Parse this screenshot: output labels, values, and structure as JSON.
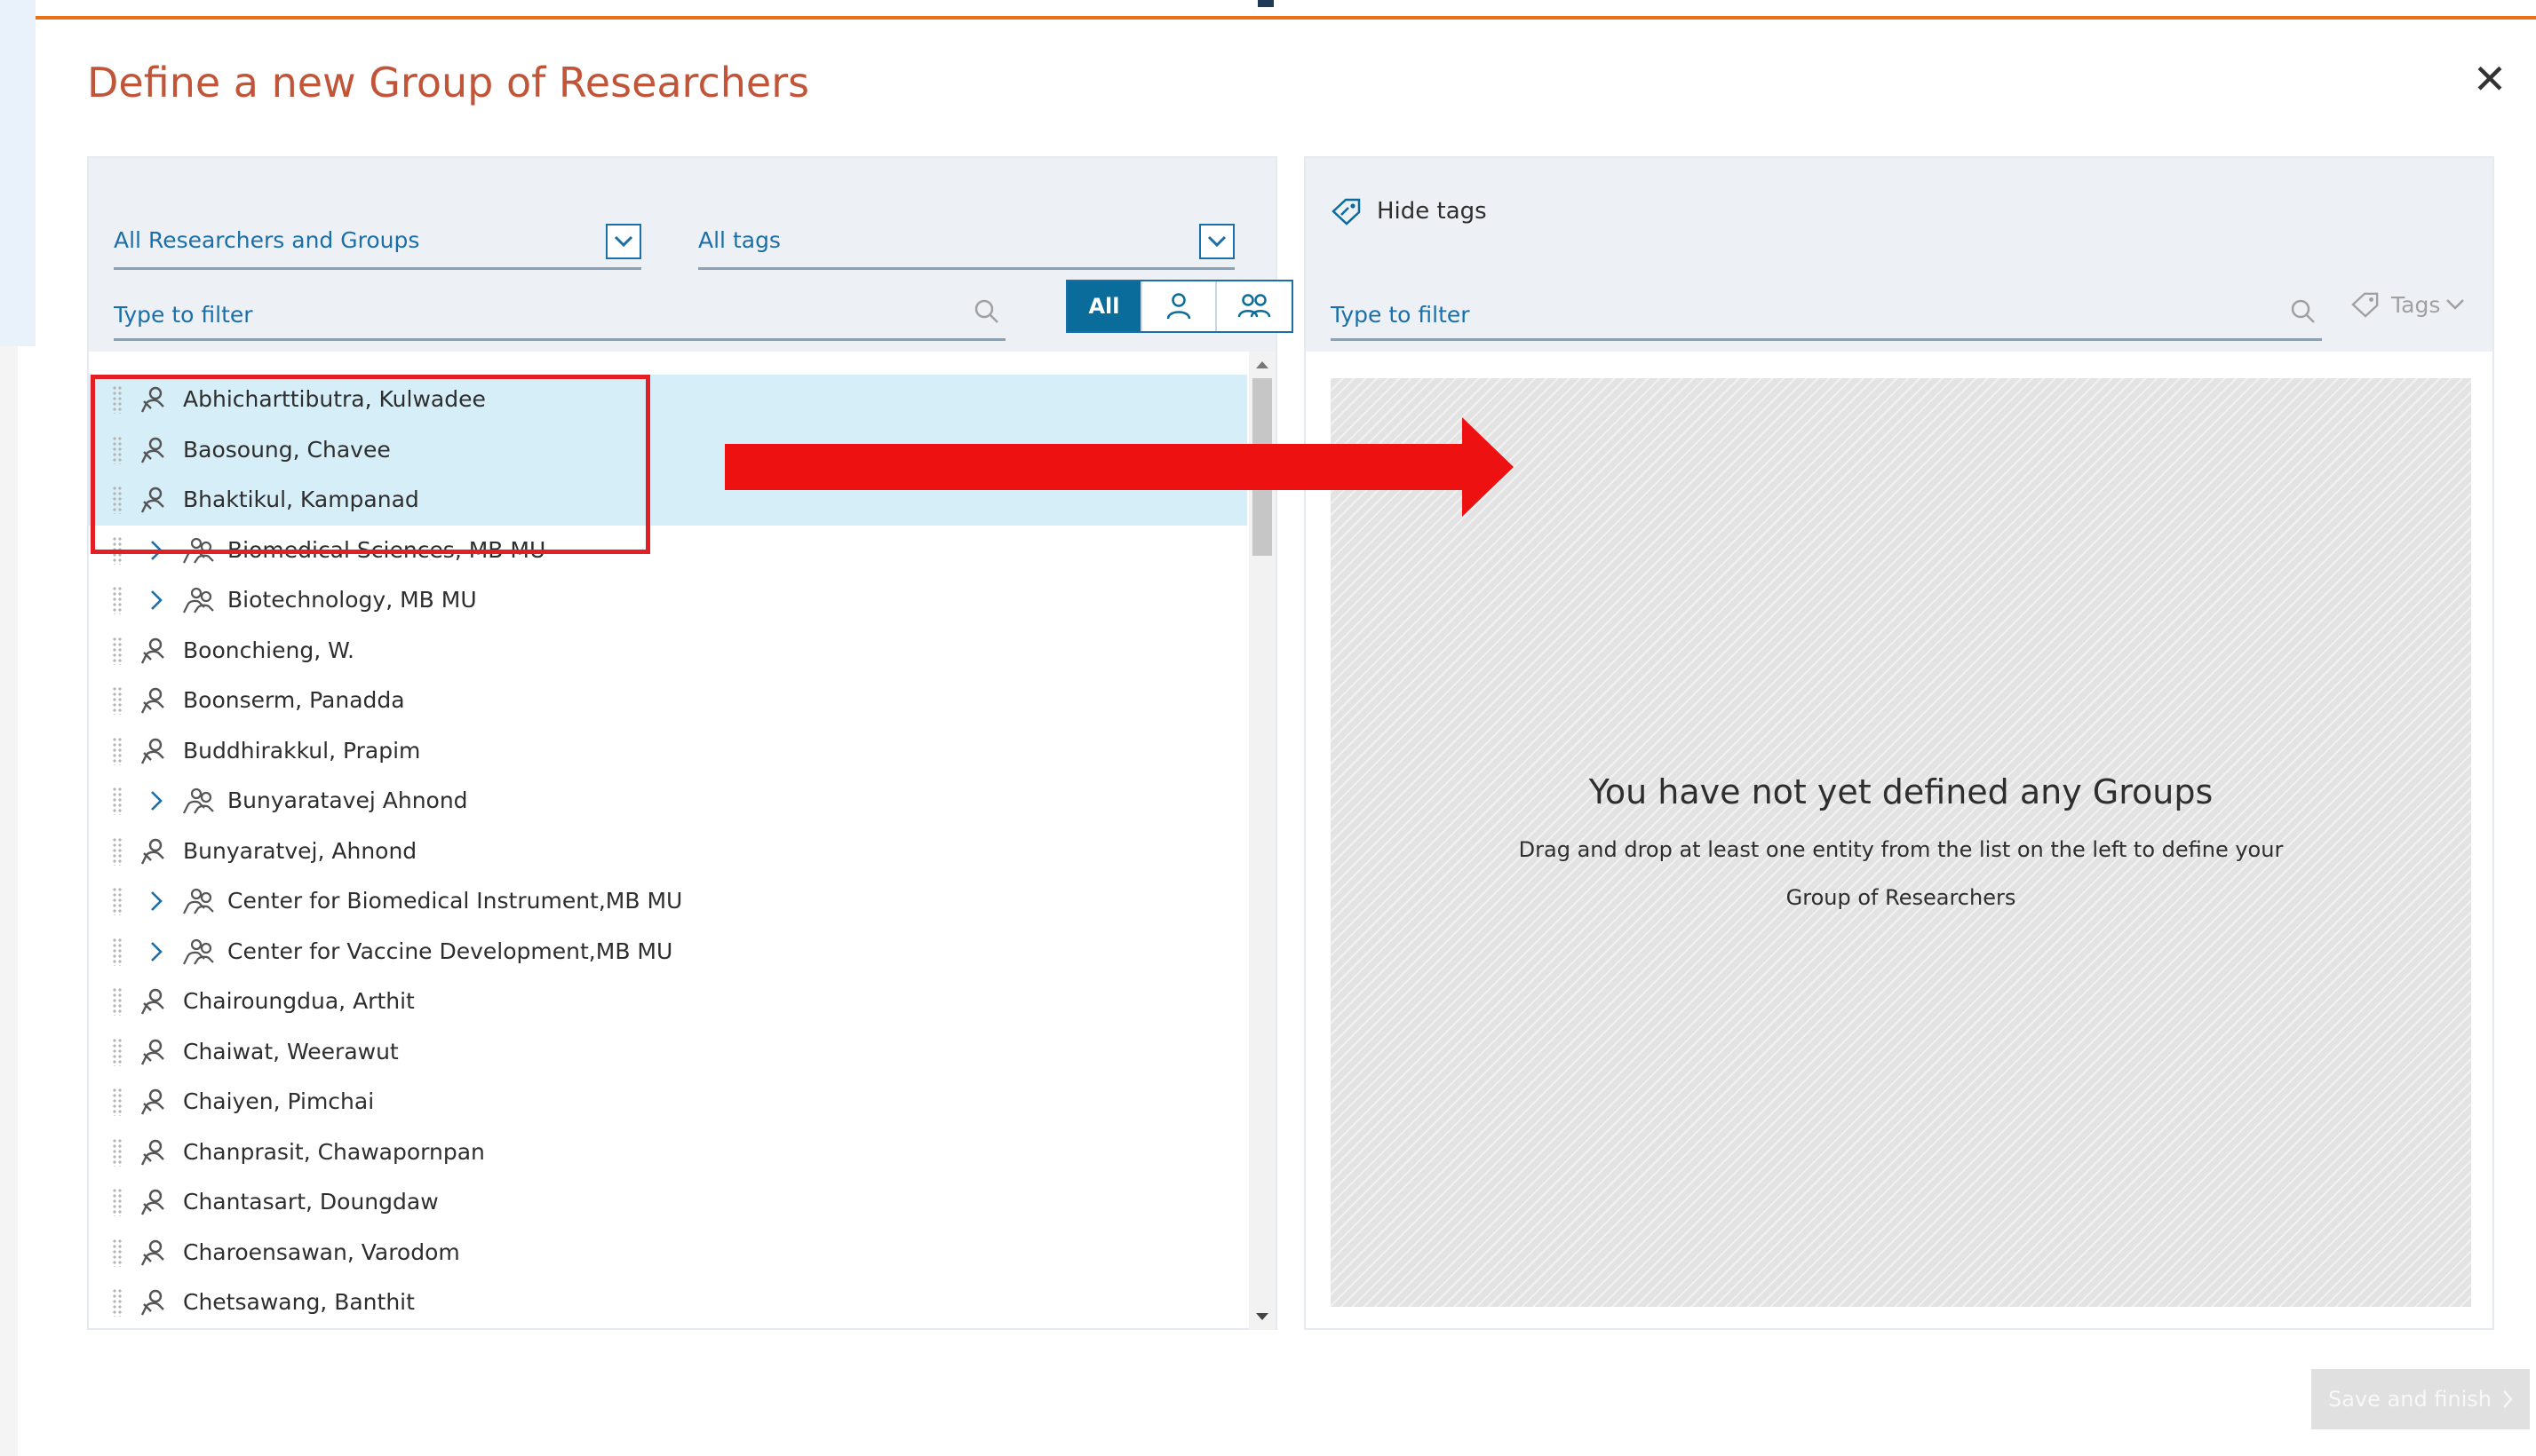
{
  "dialog": {
    "title": "Define a new Group of Researchers",
    "close_label": "✕",
    "save_label": "Save and finish"
  },
  "left": {
    "scope_dropdown": "All Researchers and Groups",
    "tags_dropdown": "All tags",
    "filter_placeholder": "Type to filter",
    "seg_all": "All",
    "items": [
      {
        "type": "person",
        "name": "Abhicharttibutra, Kulwadee",
        "selected": true
      },
      {
        "type": "person",
        "name": "Baosoung, Chavee",
        "selected": true
      },
      {
        "type": "person",
        "name": "Bhaktikul, Kampanad",
        "selected": true
      },
      {
        "type": "group",
        "name": "Biomedical Sciences, MB MU",
        "selected": false
      },
      {
        "type": "group",
        "name": "Biotechnology, MB MU",
        "selected": false
      },
      {
        "type": "person",
        "name": "Boonchieng, W.",
        "selected": false
      },
      {
        "type": "person",
        "name": "Boonserm, Panadda",
        "selected": false
      },
      {
        "type": "person",
        "name": "Buddhirakkul, Prapim",
        "selected": false
      },
      {
        "type": "group",
        "name": "Bunyaratavej Ahnond",
        "selected": false
      },
      {
        "type": "person",
        "name": "Bunyaratvej, Ahnond",
        "selected": false
      },
      {
        "type": "group",
        "name": "Center for Biomedical Instrument,MB MU",
        "selected": false
      },
      {
        "type": "group",
        "name": "Center for Vaccine Development,MB MU",
        "selected": false
      },
      {
        "type": "person",
        "name": "Chairoungdua, Arthit",
        "selected": false
      },
      {
        "type": "person",
        "name": "Chaiwat, Weerawut",
        "selected": false
      },
      {
        "type": "person",
        "name": "Chaiyen, Pimchai",
        "selected": false
      },
      {
        "type": "person",
        "name": "Chanprasit, Chawapornpan",
        "selected": false
      },
      {
        "type": "person",
        "name": "Chantasart, Doungdaw",
        "selected": false
      },
      {
        "type": "person",
        "name": "Charoensawan, Varodom",
        "selected": false
      },
      {
        "type": "person",
        "name": "Chetsawang, Banthit",
        "selected": false
      }
    ]
  },
  "right": {
    "hide_tags_label": "Hide tags",
    "filter_placeholder": "Type to filter",
    "tags_label": "Tags",
    "empty_title": "You have not yet defined any Groups",
    "empty_line1": "Drag and drop at least one entity from the list on the left to define your",
    "empty_line2": "Group of Researchers"
  },
  "colors": {
    "title": "#c0553a",
    "accent": "#0a6c9b",
    "link": "#1a6fa8",
    "selection": "#d6eef8",
    "highlight_red": "#e31e24"
  },
  "icons": {
    "person": "person-icon",
    "group": "group-icon",
    "search": "search-icon",
    "tag": "tag-icon",
    "chevron": "chevron-down-icon"
  }
}
